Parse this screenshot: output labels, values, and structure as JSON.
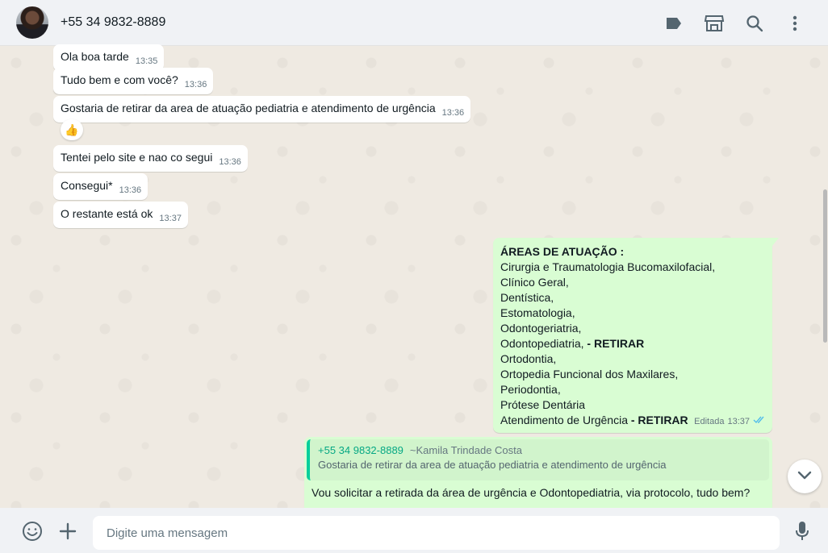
{
  "header": {
    "contact_name": "+55 34 9832-8889",
    "icons": [
      "label-icon",
      "catalog-icon",
      "search-icon",
      "menu-icon"
    ]
  },
  "messages": [
    {
      "text": "Ola boa tarde",
      "time": "13:35"
    },
    {
      "text": "Tudo bem e com você?",
      "time": "13:36"
    },
    {
      "text": "Gostaria de retirar da area de atuação pediatria e atendimento de urgência",
      "time": "13:36",
      "reaction": "👍"
    },
    {
      "text": "Tentei pelo site e nao co segui",
      "time": "13:36"
    },
    {
      "text": "Consegui*",
      "time": "13:36"
    },
    {
      "text": "O restante está ok",
      "time": "13:37"
    }
  ],
  "areas_message": {
    "title": "ÁREAS DE ATUAÇÃO :",
    "lines": [
      {
        "text": "Cirurgia e Traumatologia Bucomaxilofacial,",
        "bold": ""
      },
      {
        "text": "Clínico Geral,",
        "bold": ""
      },
      {
        "text": "Dentística,",
        "bold": ""
      },
      {
        "text": "Estomatologia,",
        "bold": ""
      },
      {
        "text": "Odontogeriatria,",
        "bold": ""
      },
      {
        "text": "Odontopediatria, ",
        "bold": "- RETIRAR"
      },
      {
        "text": "Ortodontia,",
        "bold": ""
      },
      {
        "text": "Ortopedia Funcional dos Maxilares,",
        "bold": ""
      },
      {
        "text": "Periodontia,",
        "bold": ""
      },
      {
        "text": "Prótese Dentária",
        "bold": ""
      },
      {
        "text": "Atendimento de Urgência ",
        "bold": "- RETIRAR"
      }
    ],
    "edited_label": "Editada",
    "time": "13:37",
    "status_color": "#53bdeb"
  },
  "reply_message": {
    "quote_sender": "+55 34 9832-8889",
    "quote_alias": "~Kamila Trindade Costa",
    "quote_text": "Gostaria de retirar da area de atuação pediatria e atendimento de urgência",
    "text": "Vou solicitar a retirada da área de urgência e Odontopediatria, via protocolo, tudo bem?"
  },
  "composer": {
    "placeholder": "Digite uma mensagem"
  },
  "colors": {
    "outgoing_bubble": "#d9fdd3",
    "incoming_bubble": "#ffffff",
    "accent": "#06cf9c",
    "background": "#efeae2"
  }
}
